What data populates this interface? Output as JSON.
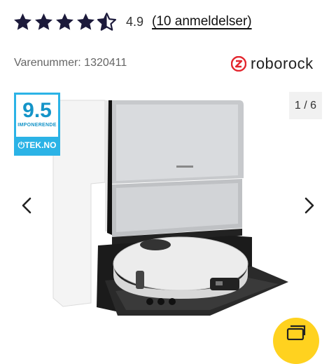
{
  "rating": {
    "value": "4.9",
    "reviews_label": "(10 anmeldelser)",
    "stars": 4.5,
    "star_color": "#1c1a3b"
  },
  "product": {
    "sku_label": "Varenummer: 1320411",
    "brand": "roborock",
    "brand_color": "#e3262e",
    "image_logo_text": "roborock"
  },
  "badge": {
    "score": "9.5",
    "label": "IMPONERENDE",
    "source": "TEK.NO",
    "color": "#2bb3e6"
  },
  "gallery": {
    "counter": "1 / 6",
    "prev_icon": "chevron-left-icon",
    "next_icon": "chevron-right-icon"
  },
  "fab": {
    "icon": "gallery-icon",
    "color": "#ffd21f"
  }
}
